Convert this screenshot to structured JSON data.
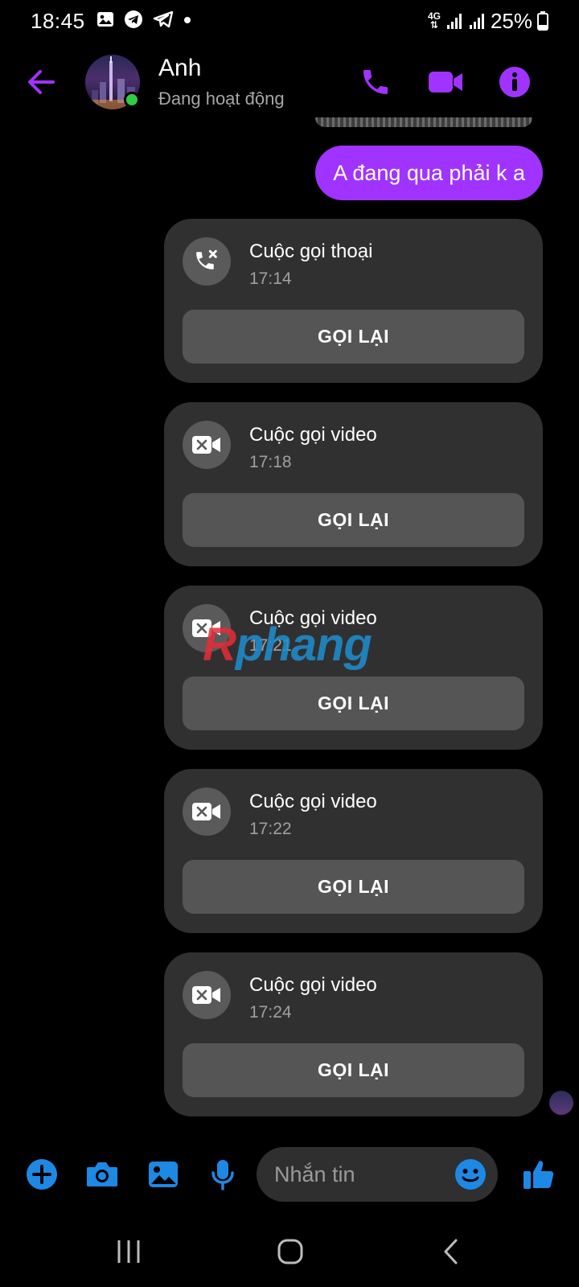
{
  "status_bar": {
    "time": "18:45",
    "network": "4G",
    "battery": "25%"
  },
  "header": {
    "contact_name": "Anh",
    "contact_status": "Đang hoạt động",
    "icons": [
      "back-arrow-icon",
      "phone-icon",
      "video-camera-icon",
      "info-icon"
    ]
  },
  "messages": {
    "outgoing_text": "A đang qua phải k a"
  },
  "calls": [
    {
      "title": "Cuộc gọi thoại",
      "time": "17:14",
      "type": "voice",
      "button": "GỌI LẠI"
    },
    {
      "title": "Cuộc gọi video",
      "time": "17:18",
      "type": "video",
      "button": "GỌI LẠI"
    },
    {
      "title": "Cuộc gọi video",
      "time": "17:21",
      "type": "video",
      "button": "GỌI LẠI"
    },
    {
      "title": "Cuộc gọi video",
      "time": "17:22",
      "type": "video",
      "button": "GỌI LẠI"
    },
    {
      "title": "Cuộc gọi video",
      "time": "17:24",
      "type": "video",
      "button": "GỌI LẠI"
    }
  ],
  "watermark": {
    "part1": "R",
    "part2": "phang"
  },
  "composer": {
    "placeholder": "Nhắn tin",
    "icons": [
      "plus-icon",
      "camera-icon",
      "gallery-icon",
      "microphone-icon",
      "emoji-icon",
      "thumbs-up-icon"
    ]
  },
  "colors": {
    "accent": "#a033ff",
    "composer_blue": "#1e88e5",
    "card_bg": "#303030",
    "button_bg": "#555555",
    "online": "#31cc46"
  }
}
